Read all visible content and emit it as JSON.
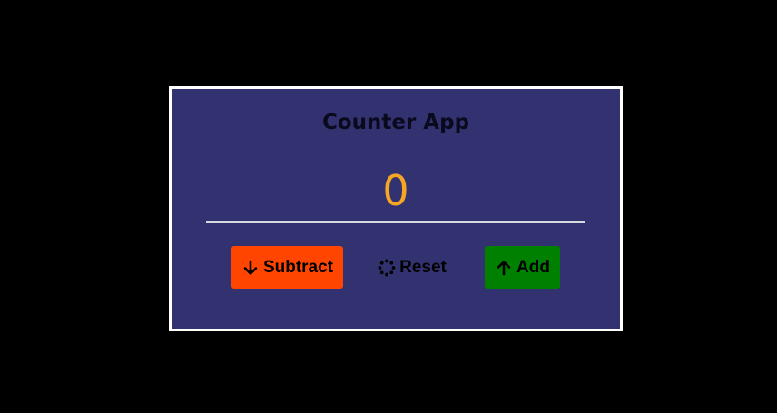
{
  "app": {
    "title": "Counter App"
  },
  "counter": {
    "value": "0",
    "value_color": "#f5a623"
  },
  "buttons": {
    "subtract": {
      "label": "Subtract",
      "icon": "arrow-down-icon",
      "color": "#ff4500"
    },
    "reset": {
      "label": "Reset",
      "icon": "spinner-icon"
    },
    "add": {
      "label": "Add",
      "icon": "arrow-up-icon",
      "color": "#008000"
    }
  },
  "colors": {
    "page_background": "#000000",
    "card_background": "#333270",
    "card_border": "#ffffff"
  }
}
